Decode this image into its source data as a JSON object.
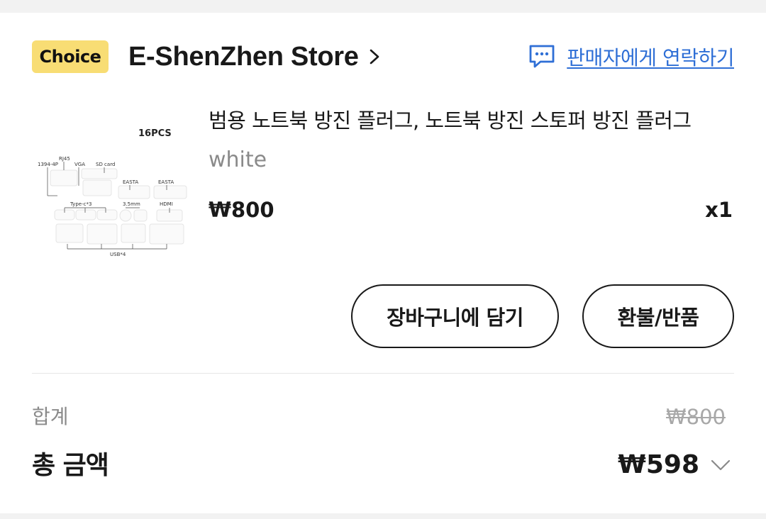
{
  "store": {
    "badge": "Choice",
    "name": "E-ShenZhen Store",
    "contact_label": "판매자에게 연락하기"
  },
  "product": {
    "title": "범용 노트북 방진 플러그, 노트북 방진 스토퍼 방진 플러그",
    "variant": "white",
    "price": "₩800",
    "quantity": "x1",
    "image_labels": {
      "pcs": "16PCS",
      "rj45": "RJ45",
      "p1394": "1394-4P",
      "vga": "VGA",
      "sd": "SD card",
      "easta1": "EASTA",
      "easta2": "EASTA",
      "typec": "Type-c*3",
      "mm35": "3.5mm",
      "hdmi": "HDMI",
      "usb": "USB*4"
    }
  },
  "actions": {
    "add_to_cart": "장바구니에 담기",
    "refund": "환불/반품"
  },
  "summary": {
    "subtotal_label": "합계",
    "subtotal_value": "₩800",
    "total_label": "총 금액",
    "total_value": "₩598"
  },
  "colors": {
    "badge": "#f8dd74",
    "link": "#2f6fd6",
    "text": "#191919",
    "muted": "#8a8a8a"
  }
}
